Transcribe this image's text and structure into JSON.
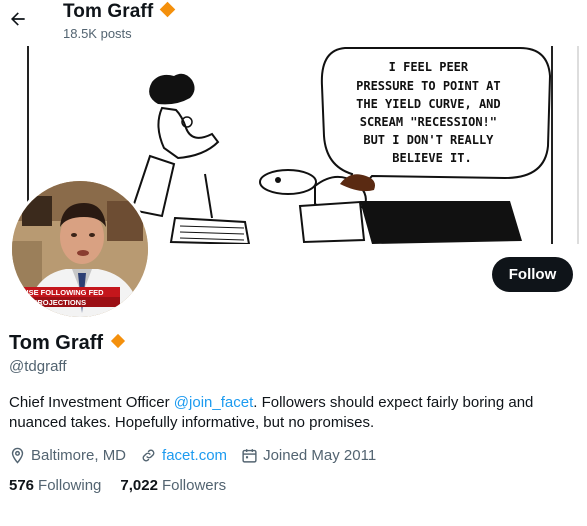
{
  "header": {
    "name": "Tom Graff",
    "posts": "18.5K posts"
  },
  "banner": {
    "cartoon_caption": [
      "I FEEL PEER",
      "PRESSURE TO POINT AT",
      "THE YIELD CURVE, AND",
      "SCREAM \"RECESSION!\"",
      "BUT I DON'T REALLY",
      "BELIEVE IT."
    ]
  },
  "avatar": {
    "chyron_line1": "S RISE FOLLOWING FED",
    "chyron_line2": "AND PROJECTIONS"
  },
  "profile": {
    "follow_label": "Follow",
    "name": "Tom Graff",
    "handle": "@tdgraff",
    "bio_before": "Chief Investment Officer ",
    "bio_mention": "@join_facet",
    "bio_after": ". Followers should expect fairly boring and nuanced takes. Hopefully informative, but no promises.",
    "location": "Baltimore, MD",
    "website": "facet.com",
    "joined": "Joined May 2011",
    "following_count": "576",
    "following_label": "Following",
    "followers_count": "7,022",
    "followers_label": "Followers"
  },
  "colors": {
    "accent": "#1d9bf0",
    "badge": "#f4900c",
    "text": "#0f1419",
    "muted": "#536471"
  },
  "icons": [
    "back-arrow-icon",
    "verified-badge-icon",
    "location-pin-icon",
    "link-icon",
    "calendar-icon"
  ]
}
